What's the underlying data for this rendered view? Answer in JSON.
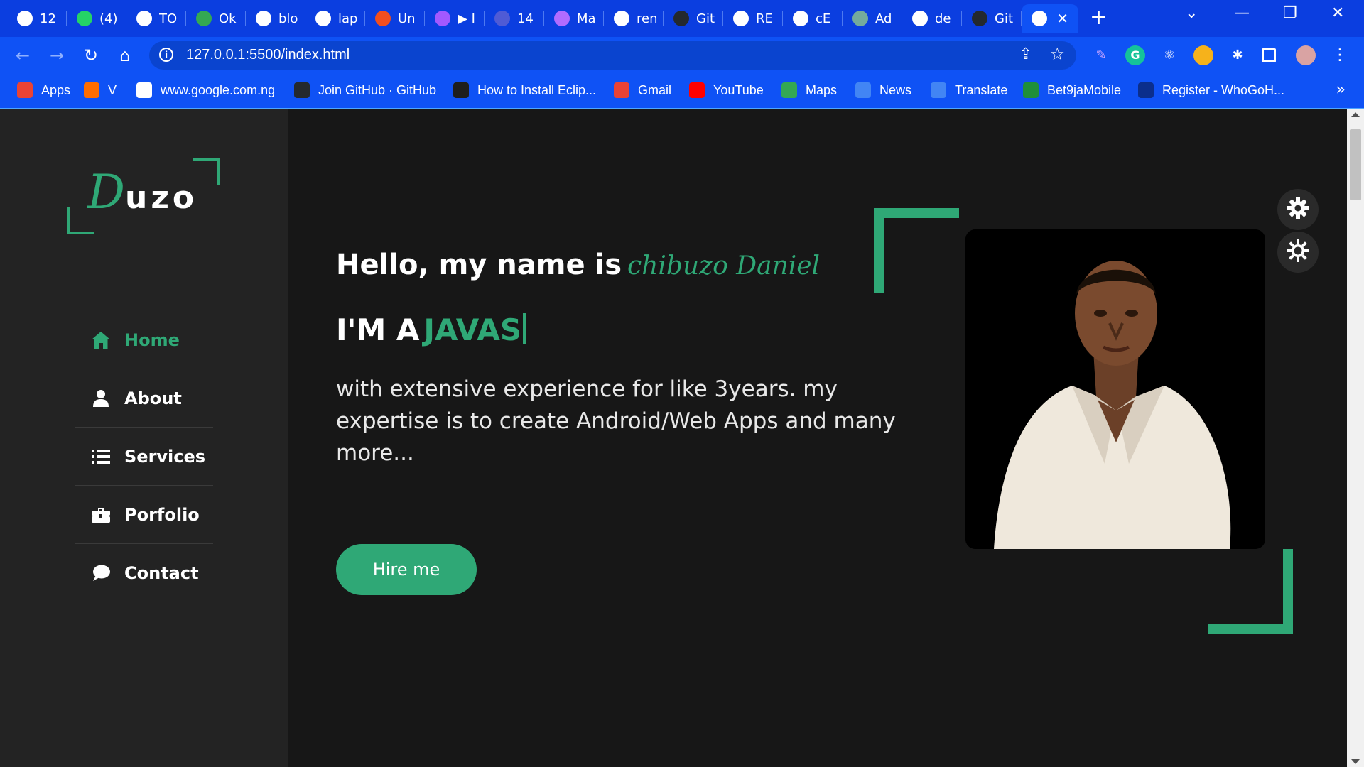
{
  "browser": {
    "tabs": [
      {
        "title": "12",
        "icon": "globe-icon",
        "color": "#ffffff"
      },
      {
        "title": "(4)",
        "icon": "whatsapp-icon",
        "color": "#25d366"
      },
      {
        "title": "TO",
        "icon": "globe-icon",
        "color": "#ffffff"
      },
      {
        "title": "Ok",
        "icon": "maps-pin-icon",
        "color": "#34a853"
      },
      {
        "title": "blo",
        "icon": "globe-icon",
        "color": "#ffffff"
      },
      {
        "title": "lap",
        "icon": "google-icon",
        "color": "#ffffff"
      },
      {
        "title": "Un",
        "icon": "figma-icon",
        "color": "#f24e1e"
      },
      {
        "title": "▶ I",
        "icon": "figma-icon",
        "color": "#a259ff"
      },
      {
        "title": "14",
        "icon": "word-icon",
        "color": "#4f5bd5"
      },
      {
        "title": "Ma",
        "icon": "m-logo-icon",
        "color": "#b06cff"
      },
      {
        "title": "ren",
        "icon": "google-icon",
        "color": "#ffffff"
      },
      {
        "title": "Git",
        "icon": "github-icon",
        "color": "#24292e"
      },
      {
        "title": "RE",
        "icon": "globe-icon",
        "color": "#ffffff"
      },
      {
        "title": "cE",
        "icon": "globe-icon",
        "color": "#ffffff"
      },
      {
        "title": "Ad",
        "icon": "chatgpt-icon",
        "color": "#74aa9c"
      },
      {
        "title": "de",
        "icon": "google-icon",
        "color": "#ffffff"
      },
      {
        "title": "Git",
        "icon": "github-icon",
        "color": "#24292e"
      }
    ],
    "active_tab": {
      "icon": "globe-icon",
      "close": "✕"
    },
    "new_tab": "+",
    "window_controls": {
      "dropdown": "⌄",
      "minimize": "—",
      "restore": "❐",
      "close": "✕"
    },
    "url": "127.0.0.1:5500/index.html",
    "bookmarks": [
      {
        "label": "Apps",
        "icon": "apps-grid-icon",
        "color": "#ea4335"
      },
      {
        "label": "V",
        "icon": "sun-icon",
        "color": "#ff6d00"
      },
      {
        "label": "www.google.com.ng",
        "icon": "google-icon",
        "color": "#ffffff"
      },
      {
        "label": "Join GitHub · GitHub",
        "icon": "github-icon",
        "color": "#24292e"
      },
      {
        "label": "How to Install Eclip...",
        "icon": "terminal-icon",
        "color": "#1e1e1e"
      },
      {
        "label": "Gmail",
        "icon": "gmail-icon",
        "color": "#ea4335"
      },
      {
        "label": "YouTube",
        "icon": "youtube-icon",
        "color": "#ff0000"
      },
      {
        "label": "Maps",
        "icon": "maps-pin-icon",
        "color": "#34a853"
      },
      {
        "label": "News",
        "icon": "news-icon",
        "color": "#4285f4"
      },
      {
        "label": "Translate",
        "icon": "translate-icon",
        "color": "#4285f4"
      },
      {
        "label": "Bet9jaMobile",
        "icon": "bet9ja-icon",
        "color": "#1f8f3a"
      },
      {
        "label": "Register - WhoGoH...",
        "icon": "whogohost-icon",
        "color": "#0b2e8c"
      }
    ],
    "bookmarks_more": "»"
  },
  "sidebar": {
    "logo": {
      "letter": "D",
      "rest": "uzo"
    },
    "items": [
      {
        "label": "Home",
        "icon": "home-icon",
        "active": true
      },
      {
        "label": "About",
        "icon": "user-icon",
        "active": false
      },
      {
        "label": "Services",
        "icon": "list-icon",
        "active": false
      },
      {
        "label": "Porfolio",
        "icon": "briefcase-icon",
        "active": false
      },
      {
        "label": "Contact",
        "icon": "chat-bubble-icon",
        "active": false
      }
    ]
  },
  "hero": {
    "greeting": "Hello, my name is",
    "name": "chibuzo Daniel",
    "role_prefix": "I'M A",
    "role_typed": "JAVAS",
    "description": "with extensive experience for like 3years. my expertise is to create Android/Web Apps and many more...",
    "cta": "Hire me"
  },
  "colors": {
    "accent": "#2fa876",
    "page_bg": "#171717",
    "sidebar_bg": "#232323",
    "browser_blue": "#0f52f5"
  }
}
